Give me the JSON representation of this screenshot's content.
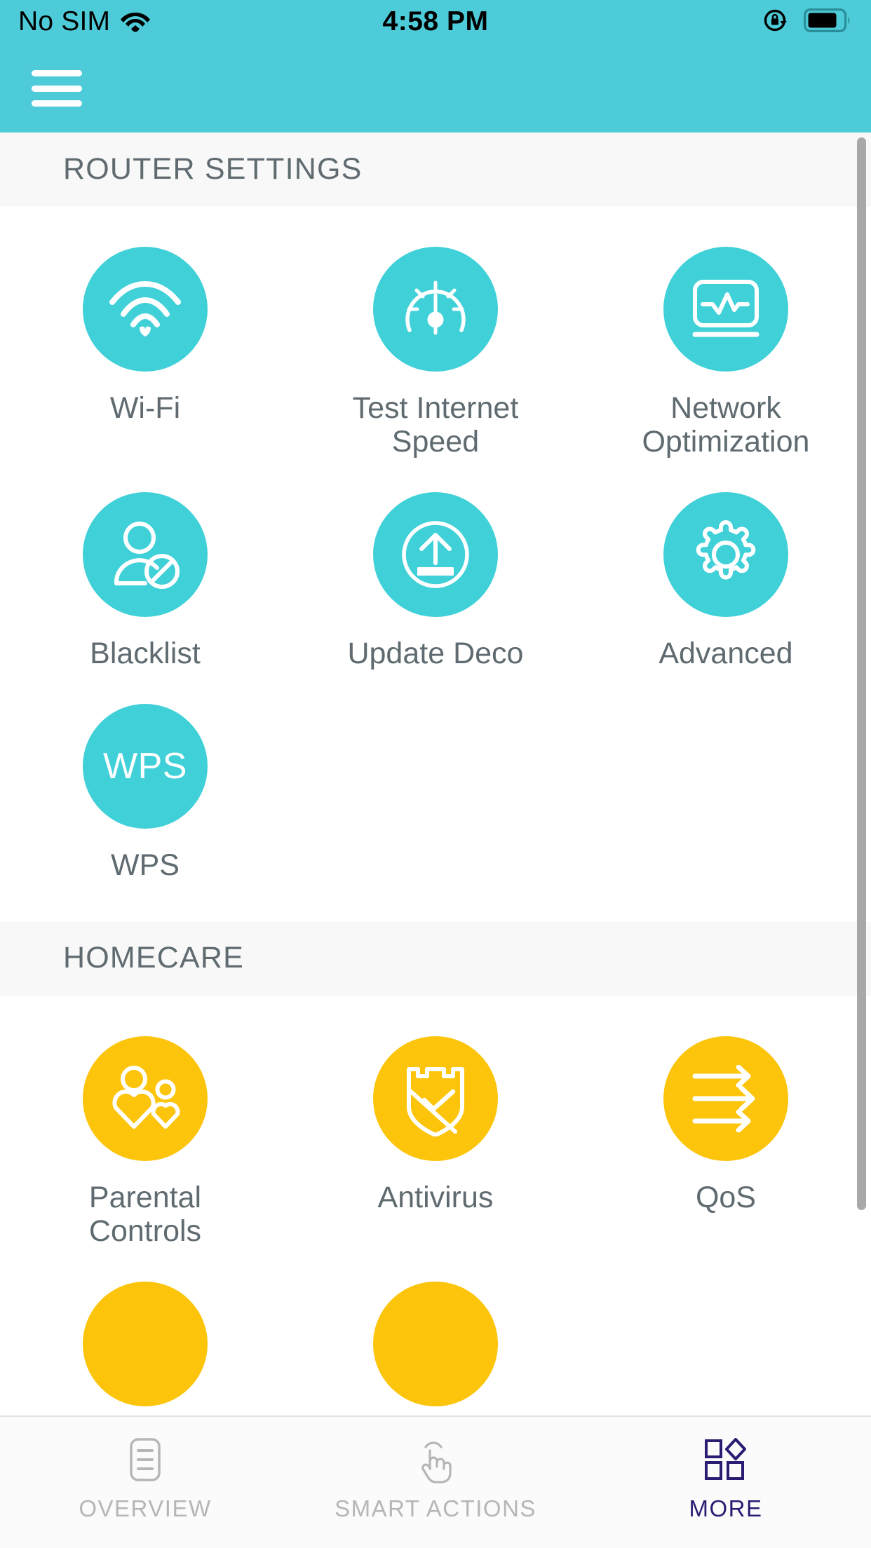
{
  "status_bar": {
    "carrier": "No SIM",
    "wifi_icon": "wifi-icon",
    "time": "4:58 PM",
    "rotation_lock_icon": "rotation-lock-icon",
    "battery_icon": "battery-icon"
  },
  "app_bar": {
    "menu_icon": "hamburger-menu-icon"
  },
  "sections": [
    {
      "title": "ROUTER SETTINGS",
      "color": "#3fd0d8",
      "items": [
        {
          "label": "Wi-Fi",
          "icon": "wifi-signal-icon"
        },
        {
          "label": "Test Internet Speed",
          "icon": "speedometer-icon"
        },
        {
          "label": "Network Optimization",
          "icon": "monitor-pulse-icon"
        },
        {
          "label": "Blacklist",
          "icon": "user-blocked-icon"
        },
        {
          "label": "Update Deco",
          "icon": "upload-circle-icon"
        },
        {
          "label": "Advanced",
          "icon": "gear-icon"
        },
        {
          "label": "WPS",
          "icon": "wps-text-icon",
          "icon_text": "WPS"
        }
      ]
    },
    {
      "title": "HOMECARE",
      "color": "#fcc40b",
      "items": [
        {
          "label": "Parental Controls",
          "icon": "parent-child-hearts-icon"
        },
        {
          "label": "Antivirus",
          "icon": "shield-check-icon"
        },
        {
          "label": "QoS",
          "icon": "three-arrows-icon"
        }
      ]
    }
  ],
  "tab_bar": {
    "tabs": [
      {
        "label": "OVERVIEW",
        "icon": "list-document-icon",
        "active": false
      },
      {
        "label": "SMART ACTIONS",
        "icon": "tap-hand-icon",
        "active": false
      },
      {
        "label": "MORE",
        "icon": "grid-diamond-icon",
        "active": true
      }
    ],
    "active_color": "#2b1b72",
    "inactive_color": "#b6b6b6"
  },
  "colors": {
    "header_teal": "#4ecbd8",
    "bubble_teal": "#3fd0d8",
    "bubble_amber": "#fcc40b",
    "section_bg": "#f8f8f8",
    "label_gray": "#5f6b70"
  }
}
